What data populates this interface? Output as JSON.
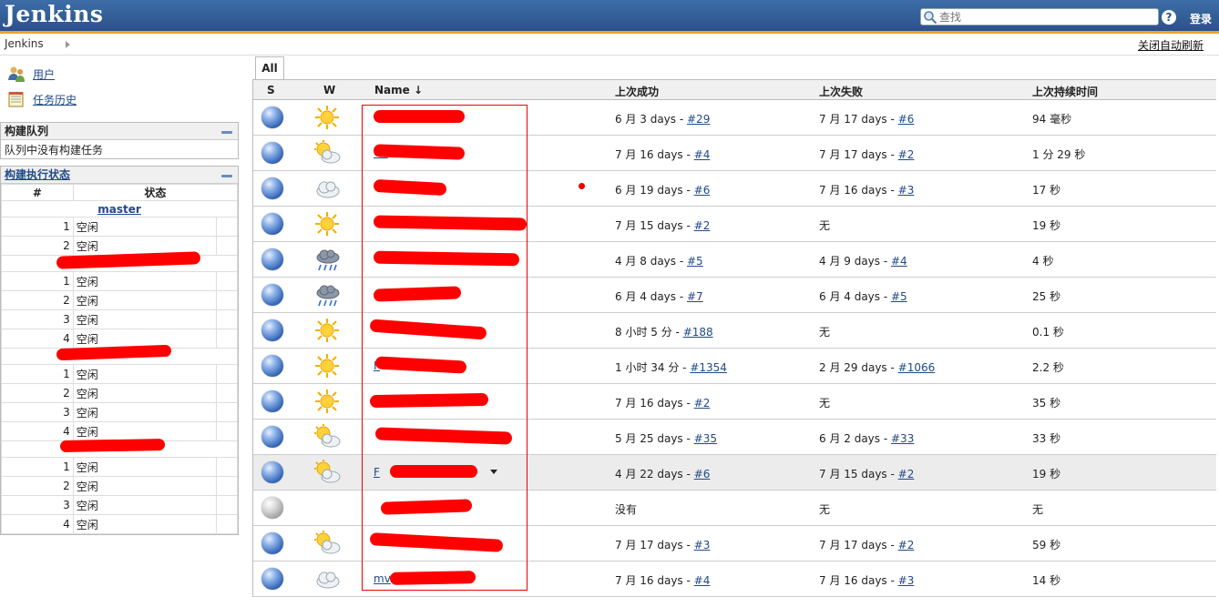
{
  "header": {
    "logo": "Jenkins",
    "search_placeholder": "查找",
    "login": "登录"
  },
  "breadcrumb": {
    "root": "Jenkins",
    "auto_refresh": "关闭自动刷新"
  },
  "sidebar": {
    "links": [
      {
        "label": "用户",
        "icon": "users-icon"
      },
      {
        "label": "任务历史",
        "icon": "notepad-icon"
      }
    ],
    "build_queue": {
      "title": "构建队列",
      "empty_text": "队列中没有构建任务"
    },
    "executors": {
      "title": "构建执行状态",
      "col_num": "#",
      "col_state": "状态",
      "groups": [
        {
          "node": "master",
          "rows": [
            {
              "n": "1",
              "s": "空闲"
            },
            {
              "n": "2",
              "s": "空闲"
            }
          ]
        },
        {
          "node": "",
          "rows": [
            {
              "n": "1",
              "s": "空闲"
            },
            {
              "n": "2",
              "s": "空闲"
            },
            {
              "n": "3",
              "s": "空闲"
            },
            {
              "n": "4",
              "s": "空闲"
            }
          ]
        },
        {
          "node": "",
          "rows": [
            {
              "n": "1",
              "s": "空闲"
            },
            {
              "n": "2",
              "s": "空闲"
            },
            {
              "n": "3",
              "s": "空闲"
            },
            {
              "n": "4",
              "s": "空闲"
            }
          ]
        },
        {
          "node": "",
          "rows": [
            {
              "n": "1",
              "s": "空闲"
            },
            {
              "n": "2",
              "s": "空闲"
            },
            {
              "n": "3",
              "s": "空闲"
            },
            {
              "n": "4",
              "s": "空闲"
            }
          ]
        }
      ]
    }
  },
  "view": {
    "tab": "All"
  },
  "jobs_table": {
    "headers": {
      "s": "S",
      "w": "W",
      "name": "Name ↓",
      "last_success": "上次成功",
      "last_failure": "上次失败",
      "last_duration": "上次持续时间"
    },
    "rows": [
      {
        "status": "blue",
        "weather": "sunny",
        "name": "",
        "succ_text": "6 月 3 days - ",
        "succ_link": "#29",
        "fail_text": "7 月 17 days - ",
        "fail_link": "#6",
        "duration": "94 毫秒"
      },
      {
        "status": "blue",
        "weather": "partly-cloudy",
        "name": "Ca",
        "succ_text": "7 月 16 days - ",
        "succ_link": "#4",
        "fail_text": "7 月 17 days - ",
        "fail_link": "#2",
        "duration": "1 分 29 秒"
      },
      {
        "status": "blue",
        "weather": "cloudy",
        "name": "",
        "succ_text": "6 月 19 days - ",
        "succ_link": "#6",
        "fail_text": "7 月 16 days - ",
        "fail_link": "#3",
        "duration": "17 秒"
      },
      {
        "status": "blue",
        "weather": "sunny",
        "name": "",
        "succ_text": "7 月 15 days - ",
        "succ_link": "#2",
        "fail_text": "无",
        "fail_link": "",
        "duration": "19 秒"
      },
      {
        "status": "blue",
        "weather": "rain",
        "name": "",
        "succ_text": "4 月 8 days - ",
        "succ_link": "#5",
        "fail_text": "4 月 9 days - ",
        "fail_link": "#4",
        "duration": "4 秒"
      },
      {
        "status": "blue",
        "weather": "rain",
        "name": "",
        "succ_text": "6 月 4 days - ",
        "succ_link": "#7",
        "fail_text": "6 月 4 days - ",
        "fail_link": "#5",
        "duration": "25 秒"
      },
      {
        "status": "blue",
        "weather": "sunny",
        "name": "",
        "succ_text": "8 小时 5 分 - ",
        "succ_link": "#188",
        "fail_text": "无",
        "fail_link": "",
        "duration": "0.1 秒"
      },
      {
        "status": "blue",
        "weather": "sunny",
        "name": "F",
        "succ_text": "1 小时 34 分 - ",
        "succ_link": "#1354",
        "fail_text": "2 月 29 days - ",
        "fail_link": "#1066",
        "duration": "2.2 秒"
      },
      {
        "status": "blue",
        "weather": "sunny",
        "name": "",
        "succ_text": "7 月 16 days - ",
        "succ_link": "#2",
        "fail_text": "无",
        "fail_link": "",
        "duration": "35 秒"
      },
      {
        "status": "blue",
        "weather": "partly-cloudy",
        "name": "",
        "succ_text": "5 月 25 days - ",
        "succ_link": "#35",
        "fail_text": "6 月 2 days - ",
        "fail_link": "#33",
        "duration": "33 秒"
      },
      {
        "status": "blue",
        "weather": "partly-cloudy",
        "name": "F",
        "succ_text": "4 月 22 days - ",
        "succ_link": "#6",
        "fail_text": "7 月 15 days - ",
        "fail_link": "#2",
        "duration": "19 秒"
      },
      {
        "status": "grey",
        "weather": "none",
        "name": "",
        "succ_text": "没有",
        "succ_link": "",
        "fail_text": "无",
        "fail_link": "",
        "duration": "无"
      },
      {
        "status": "blue",
        "weather": "partly-cloudy",
        "name": "",
        "succ_text": "7 月 17 days - ",
        "succ_link": "#3",
        "fail_text": "7 月 17 days - ",
        "fail_link": "#2",
        "duration": "59 秒"
      },
      {
        "status": "blue",
        "weather": "cloudy",
        "name": "mv",
        "succ_text": "7 月 16 days - ",
        "succ_link": "#4",
        "fail_text": "7 月 16 days - ",
        "fail_link": "#3",
        "duration": "14 秒"
      }
    ]
  },
  "colors": {
    "header_blue": "#2a5388",
    "accent_orange": "#f0a22a",
    "link": "#204a87",
    "redaction": "#ff0000"
  }
}
